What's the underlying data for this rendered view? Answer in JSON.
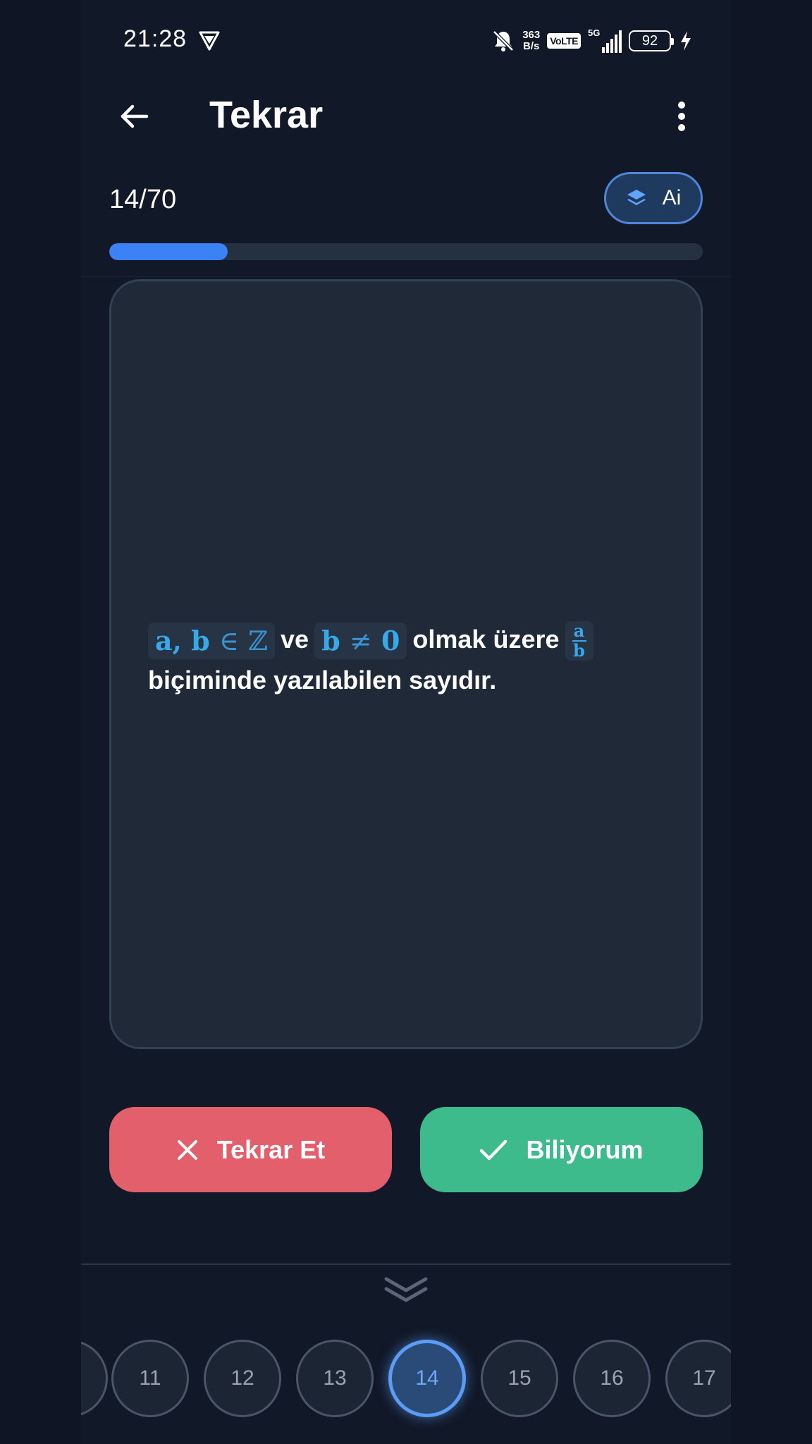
{
  "status_bar": {
    "time": "21:28",
    "net_speed_value": "363",
    "net_speed_unit": "B/s",
    "volte": "VoLTE",
    "network": "5G",
    "battery": "92"
  },
  "header": {
    "title": "Tekrar"
  },
  "progress": {
    "count": "14/70",
    "fraction": 0.2,
    "ai_label": "Ai"
  },
  "card": {
    "math_ab": "a, b",
    "math_in": "∈",
    "math_z": "ℤ",
    "word_ve": "ve",
    "math_b": "b",
    "math_neq": "≠",
    "math_zero": "0",
    "word_olmak": "olmak üzere",
    "frac_num": "a",
    "frac_den": "b",
    "line2": "biçiminde yazılabilen sayıdır."
  },
  "actions": {
    "repeat_label": "Tekrar Et",
    "know_label": "Biliyorum"
  },
  "pages": {
    "items": [
      "11",
      "12",
      "13",
      "14",
      "15",
      "16",
      "17"
    ],
    "active": "14"
  },
  "colors": {
    "background": "#111827",
    "card": "#1f2937",
    "accent": "#3b82f6",
    "repeat": "#e25f6b",
    "know": "#3ebb8d",
    "math": "#38a8e8"
  },
  "icons": {
    "back": "arrow-left-icon",
    "more": "more-vertical-icon",
    "ai": "layers-icon",
    "repeat": "close-icon",
    "know": "check-icon",
    "collapse": "chevron-double-down-icon"
  }
}
